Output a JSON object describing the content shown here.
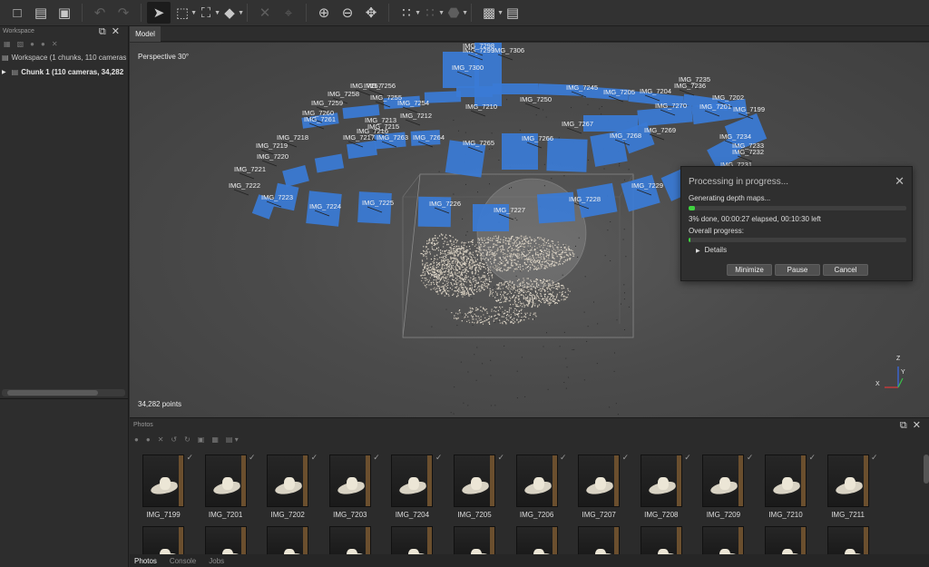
{
  "toolbar": {
    "tools": [
      {
        "name": "new-file-icon",
        "glyph": "🗎"
      },
      {
        "name": "open-folder-icon",
        "glyph": "▬"
      },
      {
        "name": "save-icon",
        "glyph": "▣"
      },
      {
        "name": "undo-icon",
        "glyph": "↶",
        "dim": true
      },
      {
        "name": "redo-icon",
        "glyph": "↷",
        "dim": true
      }
    ]
  },
  "workspace": {
    "title": "Workspace",
    "root_label": "Workspace (1 chunks, 110 cameras",
    "chunk_label": "Chunk 1 (110 cameras, 34,282"
  },
  "model": {
    "tab_label": "Model",
    "projection": "Perspective 30°",
    "points_count": "34,282 points",
    "axes": {
      "z": "Z",
      "y": "Y",
      "x": "X"
    },
    "camera_labels": [
      {
        "t": "IMG_7299"
      },
      {
        "t": "IMG_7300"
      },
      {
        "t": "IMG_7298"
      },
      {
        "t": "IMG_7306"
      },
      {
        "t": "IMG_7257"
      },
      {
        "t": "IMG_7256"
      },
      {
        "t": "IMG_7258"
      },
      {
        "t": "IMG_7255"
      },
      {
        "t": "IMG_7259"
      },
      {
        "t": "IMG_7254"
      },
      {
        "t": "IMG_7260"
      },
      {
        "t": "IMG_7261"
      },
      {
        "t": "IMG_7212"
      },
      {
        "t": "IMG_7213"
      },
      {
        "t": "IMG_7215"
      },
      {
        "t": "IMG_7216"
      },
      {
        "t": "IMG_7218"
      },
      {
        "t": "IMG_7217"
      },
      {
        "t": "IMG_7219"
      },
      {
        "t": "IMG_7220"
      },
      {
        "t": "IMG_7221"
      },
      {
        "t": "IMG_7222"
      },
      {
        "t": "IMG_7223"
      },
      {
        "t": "IMG_7224"
      },
      {
        "t": "IMG_7225"
      },
      {
        "t": "IMG_7226"
      },
      {
        "t": "IMG_7227"
      },
      {
        "t": "IMG_7228"
      },
      {
        "t": "IMG_7229"
      },
      {
        "t": "IMG_7263"
      },
      {
        "t": "IMG_7264"
      },
      {
        "t": "IMG_7265"
      },
      {
        "t": "IMG_7266"
      },
      {
        "t": "IMG_7267"
      },
      {
        "t": "IMG_7268"
      },
      {
        "t": "IMG_7269"
      },
      {
        "t": "IMG_7270"
      },
      {
        "t": "IMG_7245"
      },
      {
        "t": "IMG_7205"
      },
      {
        "t": "IMG_7204"
      },
      {
        "t": "IMG_7202"
      },
      {
        "t": "IMG_7201"
      },
      {
        "t": "IMG_7199"
      },
      {
        "t": "IMG_7234"
      },
      {
        "t": "IMG_7233"
      },
      {
        "t": "IMG_7232"
      },
      {
        "t": "IMG_7231"
      },
      {
        "t": "IMG_7235"
      },
      {
        "t": "IMG_7236"
      },
      {
        "t": "IMG_7250"
      },
      {
        "t": "IMG_7210"
      }
    ]
  },
  "dialog": {
    "title": "Processing in progress...",
    "stage": "Generating depth maps...",
    "stage_progress": 0.03,
    "status": "3% done, 00:00:27 elapsed, 00:10:30 left",
    "overall_label": "Overall progress:",
    "overall_progress": 0.01,
    "details_label": "Details",
    "buttons": {
      "minimize": "Minimize",
      "pause": "Pause",
      "cancel": "Cancel"
    }
  },
  "photos": {
    "title": "Photos",
    "row1": [
      "IMG_7199",
      "IMG_7201",
      "IMG_7202",
      "IMG_7203",
      "IMG_7204",
      "IMG_7205",
      "IMG_7206",
      "IMG_7207",
      "IMG_7208",
      "IMG_7209",
      "IMG_7210",
      "IMG_7211"
    ]
  },
  "bottom_tabs": [
    "Photos",
    "Console",
    "Jobs"
  ]
}
